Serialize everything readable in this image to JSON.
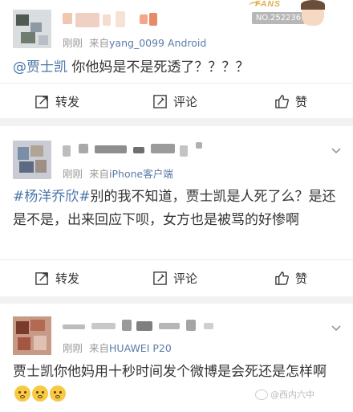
{
  "posts": [
    {
      "time": "刚刚",
      "source_prefix": "来自",
      "source": "yang_0099 Android",
      "badge": {
        "fans_label": "FANS",
        "number": "NO.252236"
      },
      "mention": "@贾士凯",
      "text": " 你他妈是不是死透了？？？？",
      "actions": {
        "repost": "转发",
        "comment": "评论",
        "like": "赞"
      }
    },
    {
      "time": "刚刚",
      "source_prefix": "来自",
      "source": "iPhone客户端",
      "topic": "#杨洋乔欣#",
      "text": "别的我不知道，贾士凯是人死了么？是还是不是，出来回应下呗，女方也是被骂的好惨啊",
      "actions": {
        "repost": "转发",
        "comment": "评论",
        "like": "赞"
      }
    },
    {
      "time": "刚刚",
      "source_prefix": "来自",
      "source": "HUAWEI P20",
      "text": "贾士凯你他妈用十秒时间发个微博是会死还是怎样啊",
      "watermark": "@西内六中"
    }
  ],
  "colors": {
    "link": "#4a76a8",
    "meta": "#999999",
    "background": "#f2f2f2"
  }
}
